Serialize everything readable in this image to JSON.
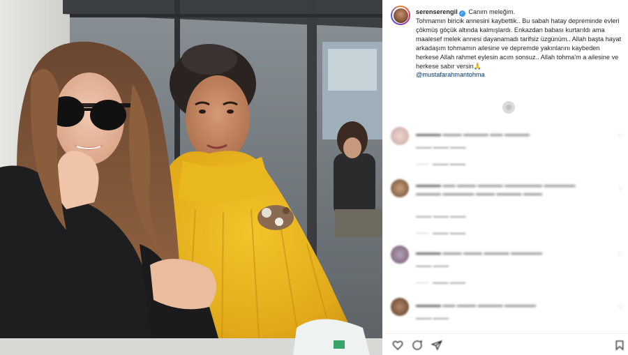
{
  "post": {
    "username": "serenserengil",
    "verified": true,
    "caption_lines": [
      "Canım meleğim.",
      "Tohmamın biricik annesini kaybettik.. Bu sabah hatay depreminde evleri çökmüş göçük altında kalmışlardı. Enkazdan babası kurtarıldı ama maalesef melek annesi dayanamadı tarifsiz üzgünüm.. Allah başta hayat arkadaşım tohmamın ailesine ve depremde yakınlarını kaybeden herkese Allah rahmet eylesin acım sonsuz.. Allah tohma'm a ailesine ve herkese sabır versin🙏",
      "@mustafarahmantohma"
    ]
  },
  "icons": {
    "verified": "verified-badge-icon",
    "heart": "heart-icon",
    "like": "heart-outline-icon",
    "comment": "comment-bubble-icon",
    "share": "paper-plane-icon",
    "save": "bookmark-icon"
  },
  "colors": {
    "accent": "#3897f0",
    "mention": "#00376b",
    "sweater": "#e8b51c"
  }
}
